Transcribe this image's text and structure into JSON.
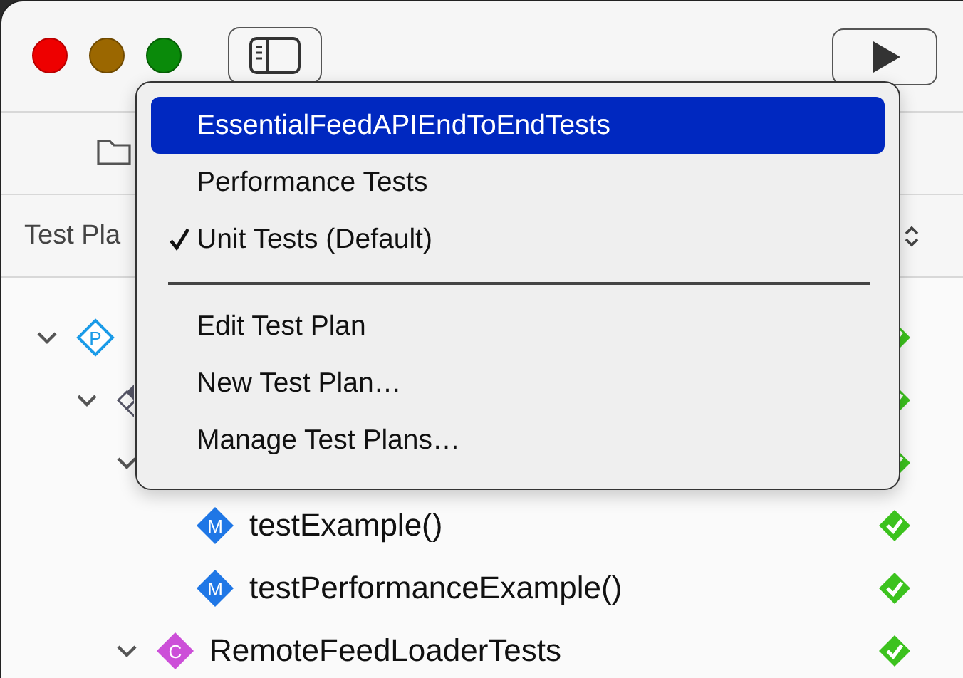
{
  "test_plan": {
    "label": "Test Pla"
  },
  "tree": [
    {
      "kind": "plan",
      "badge": "P",
      "expanded": true,
      "passed": true,
      "children": [
        {
          "kind": "target",
          "expanded": true,
          "passed": true,
          "children": [
            {
              "expanded": true,
              "passed": true,
              "children": [
                {
                  "kind": "method",
                  "badge": "M",
                  "label": "testExample()",
                  "passed": true
                },
                {
                  "kind": "method",
                  "badge": "M",
                  "label": "testPerformanceExample()",
                  "passed": true
                }
              ]
            },
            {
              "kind": "class",
              "badge": "C",
              "label": "RemoteFeedLoaderTests",
              "expanded": true,
              "passed": true
            }
          ]
        }
      ]
    }
  ],
  "menu": [
    {
      "kind": "item",
      "label": "EssentialFeedAPIEndToEndTests",
      "selected": true,
      "checked": false
    },
    {
      "kind": "item",
      "label": "Performance Tests",
      "selected": false,
      "checked": false
    },
    {
      "kind": "item",
      "label": "Unit Tests (Default)",
      "selected": false,
      "checked": true
    },
    {
      "kind": "separator"
    },
    {
      "kind": "item",
      "label": "Edit Test Plan",
      "selected": false,
      "checked": false
    },
    {
      "kind": "item",
      "label": "New Test Plan…",
      "selected": false,
      "checked": false
    },
    {
      "kind": "item",
      "label": "Manage Test Plans…",
      "selected": false,
      "checked": false
    }
  ]
}
